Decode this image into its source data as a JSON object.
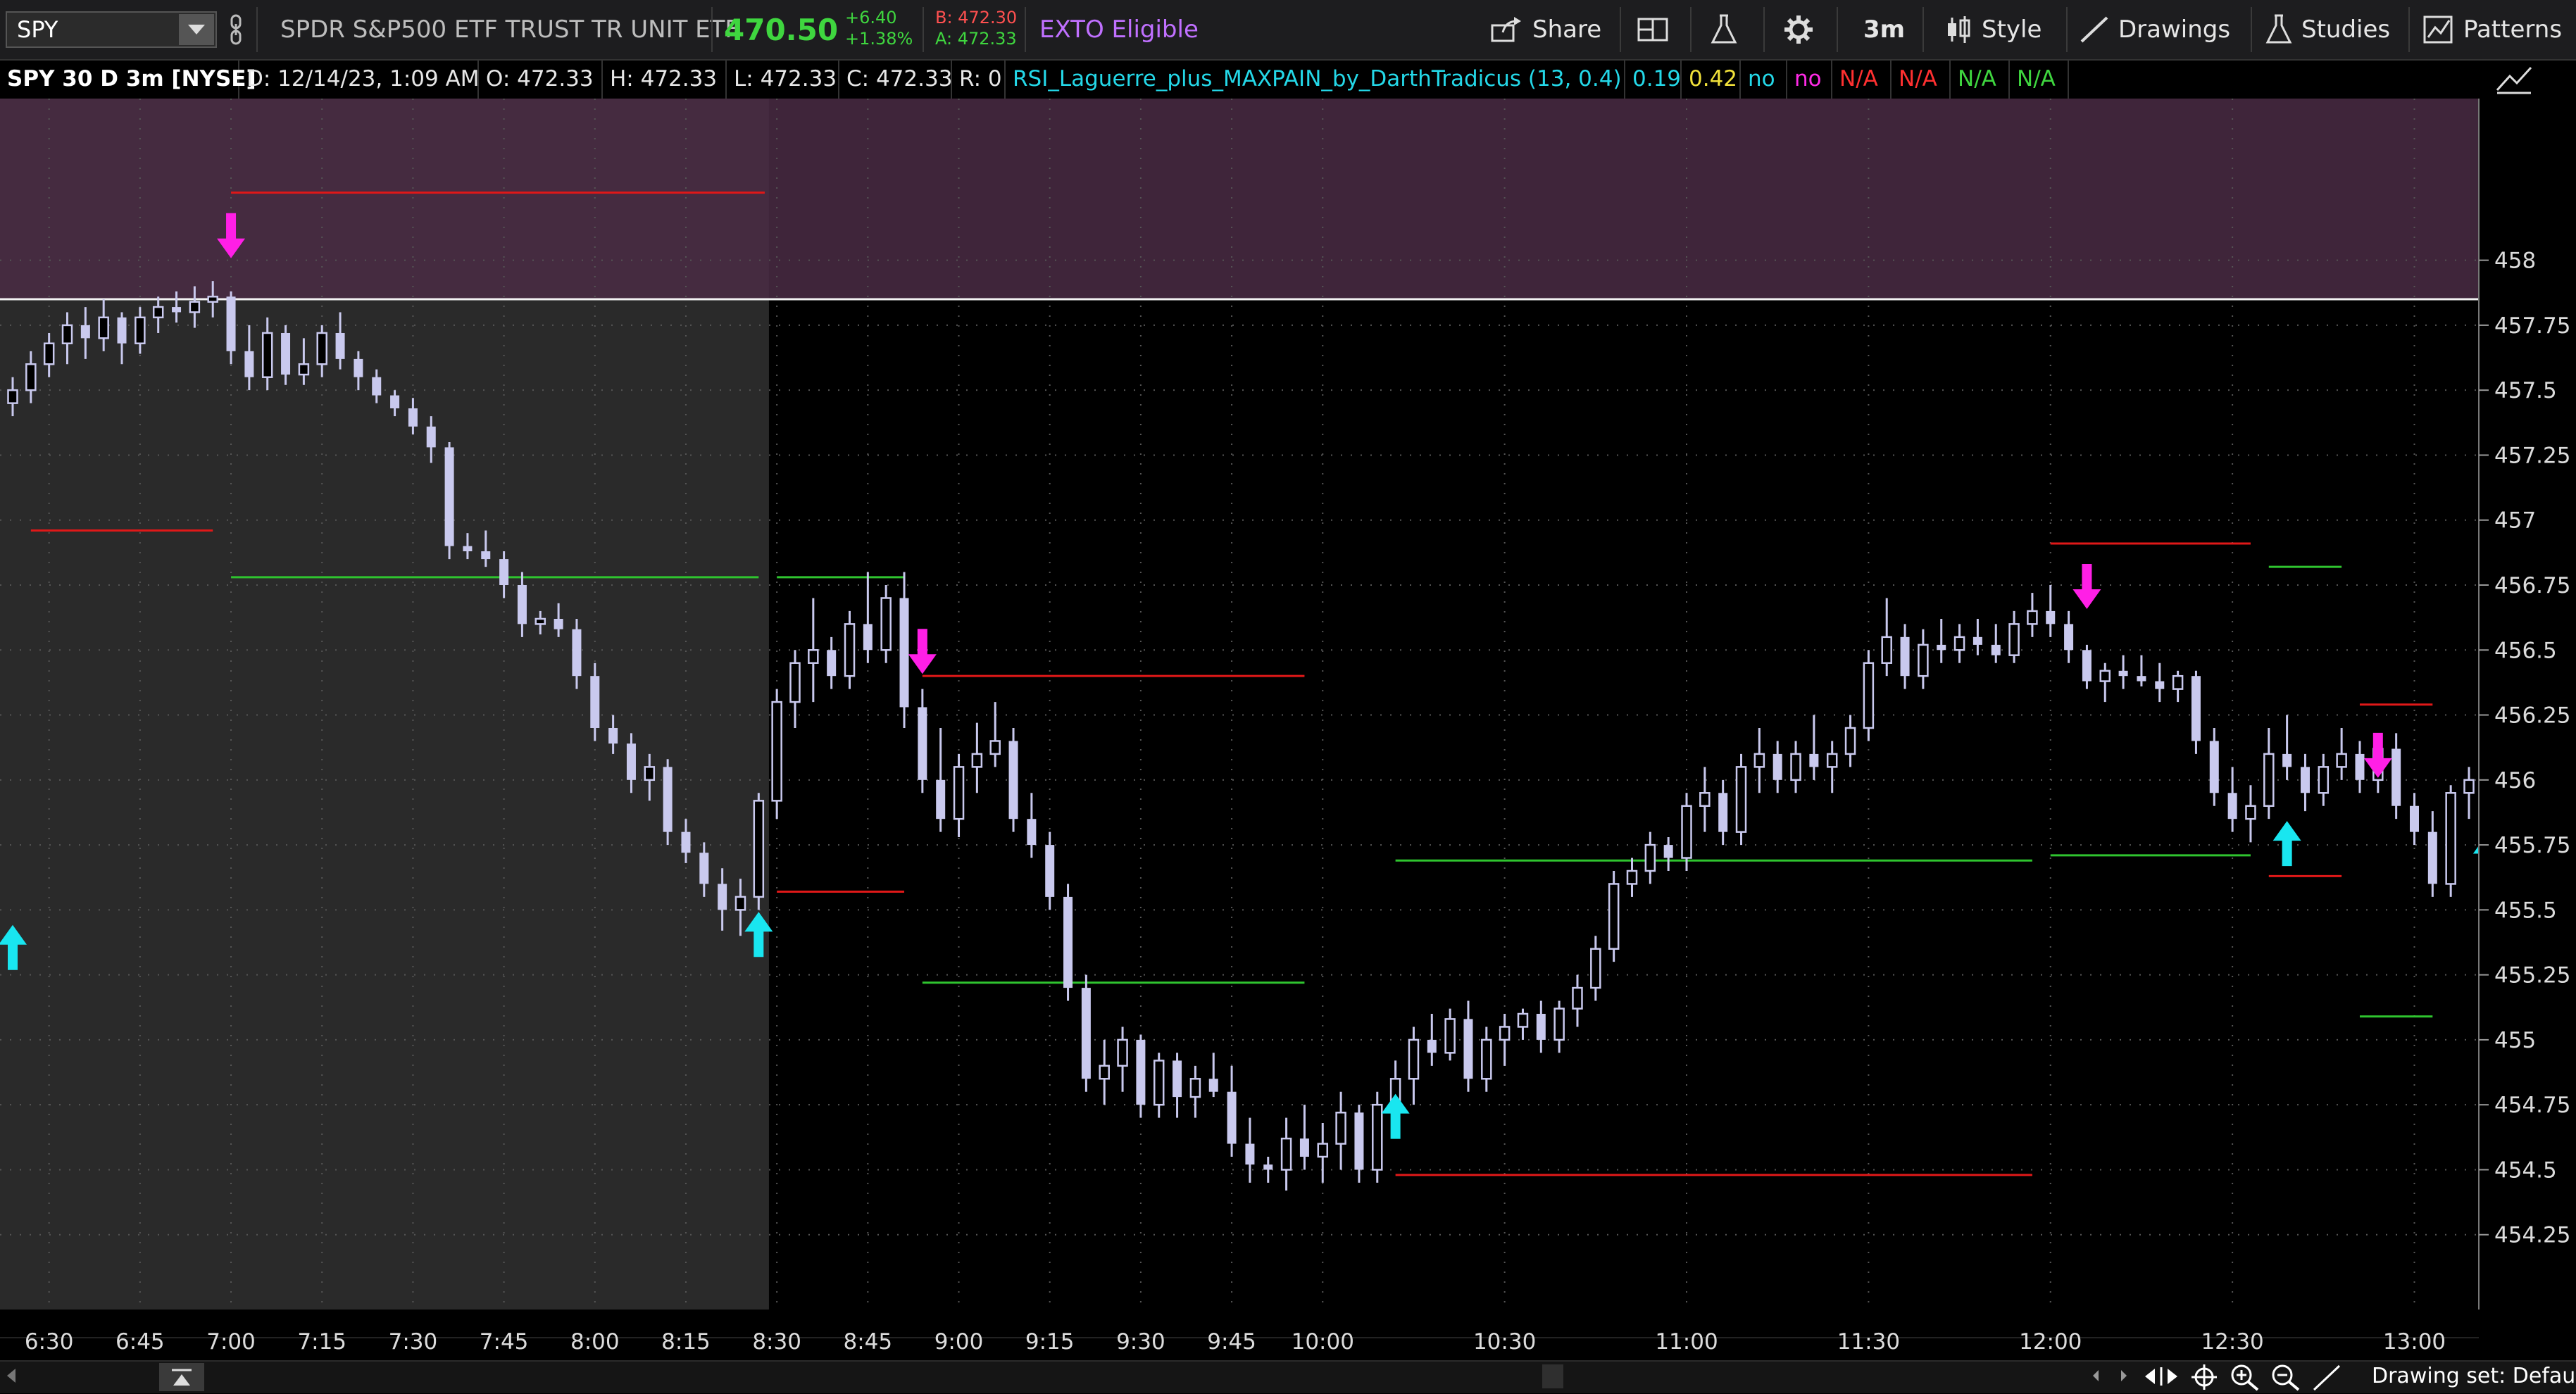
{
  "toolbar": {
    "symbol": "SPY",
    "description": "SPDR S&P500 ETF TRUST TR UNIT ETF",
    "last_price": "470.50",
    "change_abs": "+6.40",
    "change_pct": "+1.38%",
    "bid": "B: 472.30",
    "ask": "A: 472.33",
    "exto": "EXTO Eligible",
    "share": "Share",
    "timeframe": "3m",
    "style": "Style",
    "drawings": "Drawings",
    "studies": "Studies",
    "patterns": "Patterns"
  },
  "infobar": {
    "chart_title": "SPY 30 D 3m [NYSE]",
    "date": "D: 12/14/23, 1:09 AM",
    "open": "O: 472.33",
    "high": "H: 472.33",
    "low": "L: 472.33",
    "close": "C: 472.33",
    "range": "R: 0",
    "study": "RSI_Laguerre_plus_MAXPAIN_by_DarthTradicus (13, 0.4)",
    "v1": "0.19",
    "v2": "0.42",
    "v3": "no",
    "v4": "no",
    "v5": "N/A",
    "v6": "N/A",
    "v7": "N/A",
    "v8": "N/A"
  },
  "footer": {
    "drawing_set": "Drawing set: Defau"
  },
  "colors": {
    "candle": "#c9c9ee",
    "up_arrow": "#19e6f0",
    "down_arrow": "#ff1fe6",
    "red_line": "#e01818",
    "green_line": "#2fc42f",
    "premarket_bg": "#2a2a2a",
    "band": "#4a2c44"
  },
  "chart_data": {
    "type": "candlestick",
    "ylim": [
      454,
      458.4
    ],
    "xlim": [
      "6:24",
      "13:09"
    ],
    "y_ticks": [
      "458",
      "457.75",
      "457.5",
      "457.25",
      "457",
      "456.75",
      "456.5",
      "456.25",
      "456",
      "455.75",
      "455.5",
      "455.25",
      "455",
      "454.75",
      "454.5",
      "454.25"
    ],
    "x_ticks": [
      "6:30",
      "6:45",
      "7:00",
      "7:15",
      "7:30",
      "7:45",
      "8:00",
      "8:15",
      "8:30",
      "8:45",
      "9:00",
      "9:15",
      "9:30",
      "9:45",
      "10:00",
      "10:30",
      "11:00",
      "11:30",
      "12:00",
      "12:30",
      "13:00"
    ],
    "premarket_end": "8:28",
    "band": [
      457.85,
      458.3
    ],
    "white_line": 457.85,
    "candles": [
      [
        "6:24",
        457.45,
        457.55,
        457.4,
        457.5
      ],
      [
        "6:27",
        457.5,
        457.65,
        457.45,
        457.6
      ],
      [
        "6:30",
        457.6,
        457.72,
        457.55,
        457.68
      ],
      [
        "6:33",
        457.68,
        457.8,
        457.6,
        457.75
      ],
      [
        "6:36",
        457.75,
        457.82,
        457.62,
        457.7
      ],
      [
        "6:39",
        457.7,
        457.85,
        457.65,
        457.78
      ],
      [
        "6:42",
        457.78,
        457.8,
        457.6,
        457.68
      ],
      [
        "6:45",
        457.68,
        457.82,
        457.64,
        457.78
      ],
      [
        "6:48",
        457.78,
        457.86,
        457.72,
        457.82
      ],
      [
        "6:51",
        457.82,
        457.88,
        457.76,
        457.8
      ],
      [
        "6:54",
        457.8,
        457.9,
        457.74,
        457.84
      ],
      [
        "6:57",
        457.84,
        457.92,
        457.78,
        457.86
      ],
      [
        "7:00",
        457.86,
        457.88,
        457.6,
        457.65
      ],
      [
        "7:03",
        457.65,
        457.75,
        457.5,
        457.55
      ],
      [
        "7:06",
        457.55,
        457.78,
        457.5,
        457.72
      ],
      [
        "7:09",
        457.72,
        457.75,
        457.52,
        457.56
      ],
      [
        "7:12",
        457.56,
        457.7,
        457.52,
        457.6
      ],
      [
        "7:15",
        457.6,
        457.75,
        457.55,
        457.72
      ],
      [
        "7:18",
        457.72,
        457.8,
        457.58,
        457.62
      ],
      [
        "7:21",
        457.62,
        457.65,
        457.5,
        457.55
      ],
      [
        "7:24",
        457.55,
        457.58,
        457.45,
        457.48
      ],
      [
        "7:27",
        457.48,
        457.5,
        457.4,
        457.43
      ],
      [
        "7:30",
        457.43,
        457.47,
        457.33,
        457.36
      ],
      [
        "7:33",
        457.36,
        457.4,
        457.22,
        457.28
      ],
      [
        "7:36",
        457.28,
        457.3,
        456.85,
        456.9
      ],
      [
        "7:39",
        456.9,
        456.95,
        456.85,
        456.88
      ],
      [
        "7:42",
        456.88,
        456.96,
        456.82,
        456.85
      ],
      [
        "7:45",
        456.85,
        456.88,
        456.7,
        456.75
      ],
      [
        "7:48",
        456.75,
        456.8,
        456.55,
        456.6
      ],
      [
        "7:51",
        456.6,
        456.65,
        456.56,
        456.62
      ],
      [
        "7:54",
        456.62,
        456.68,
        456.55,
        456.58
      ],
      [
        "7:57",
        456.58,
        456.62,
        456.35,
        456.4
      ],
      [
        "8:00",
        456.4,
        456.45,
        456.15,
        456.2
      ],
      [
        "8:03",
        456.2,
        456.25,
        456.1,
        456.14
      ],
      [
        "8:06",
        456.14,
        456.18,
        455.95,
        456.0
      ],
      [
        "8:09",
        456.0,
        456.1,
        455.92,
        456.05
      ],
      [
        "8:12",
        456.05,
        456.08,
        455.75,
        455.8
      ],
      [
        "8:15",
        455.8,
        455.85,
        455.68,
        455.72
      ],
      [
        "8:18",
        455.72,
        455.76,
        455.55,
        455.6
      ],
      [
        "8:21",
        455.6,
        455.66,
        455.42,
        455.5
      ],
      [
        "8:24",
        455.5,
        455.62,
        455.4,
        455.55
      ],
      [
        "8:27",
        455.55,
        455.95,
        455.5,
        455.92
      ],
      [
        "8:30",
        455.92,
        456.35,
        455.85,
        456.3
      ],
      [
        "8:33",
        456.3,
        456.5,
        456.2,
        456.45
      ],
      [
        "8:36",
        456.45,
        456.7,
        456.3,
        456.5
      ],
      [
        "8:39",
        456.5,
        456.55,
        456.35,
        456.4
      ],
      [
        "8:42",
        456.4,
        456.65,
        456.35,
        456.6
      ],
      [
        "8:45",
        456.6,
        456.8,
        456.45,
        456.5
      ],
      [
        "8:48",
        456.5,
        456.75,
        456.45,
        456.7
      ],
      [
        "8:51",
        456.7,
        456.8,
        456.2,
        456.28
      ],
      [
        "8:54",
        456.28,
        456.35,
        455.95,
        456.0
      ],
      [
        "8:57",
        456.0,
        456.2,
        455.8,
        455.85
      ],
      [
        "9:00",
        455.85,
        456.1,
        455.78,
        456.05
      ],
      [
        "9:03",
        456.05,
        456.22,
        455.95,
        456.1
      ],
      [
        "9:06",
        456.1,
        456.3,
        456.05,
        456.15
      ],
      [
        "9:09",
        456.15,
        456.2,
        455.8,
        455.85
      ],
      [
        "9:12",
        455.85,
        455.95,
        455.7,
        455.75
      ],
      [
        "9:15",
        455.75,
        455.8,
        455.5,
        455.55
      ],
      [
        "9:18",
        455.55,
        455.6,
        455.15,
        455.2
      ],
      [
        "9:21",
        455.2,
        455.25,
        454.8,
        454.85
      ],
      [
        "9:24",
        454.85,
        455.0,
        454.75,
        454.9
      ],
      [
        "9:27",
        454.9,
        455.05,
        454.8,
        455.0
      ],
      [
        "9:30",
        455.0,
        455.02,
        454.7,
        454.75
      ],
      [
        "9:33",
        454.75,
        454.95,
        454.7,
        454.92
      ],
      [
        "9:36",
        454.92,
        454.95,
        454.7,
        454.78
      ],
      [
        "9:39",
        454.78,
        454.9,
        454.7,
        454.85
      ],
      [
        "9:42",
        454.85,
        454.95,
        454.78,
        454.8
      ],
      [
        "9:45",
        454.8,
        454.9,
        454.55,
        454.6
      ],
      [
        "9:48",
        454.6,
        454.7,
        454.45,
        454.52
      ],
      [
        "9:51",
        454.52,
        454.55,
        454.45,
        454.5
      ],
      [
        "9:54",
        454.5,
        454.7,
        454.42,
        454.62
      ],
      [
        "9:57",
        454.62,
        454.75,
        454.5,
        454.55
      ],
      [
        "10:00",
        454.55,
        454.68,
        454.45,
        454.6
      ],
      [
        "10:03",
        454.6,
        454.8,
        454.5,
        454.72
      ],
      [
        "10:06",
        454.72,
        454.75,
        454.45,
        454.5
      ],
      [
        "10:09",
        454.5,
        454.8,
        454.45,
        454.75
      ],
      [
        "10:12",
        454.75,
        454.92,
        454.7,
        454.85
      ],
      [
        "10:15",
        454.85,
        455.05,
        454.75,
        455.0
      ],
      [
        "10:18",
        455.0,
        455.1,
        454.9,
        454.95
      ],
      [
        "10:21",
        454.95,
        455.12,
        454.92,
        455.08
      ],
      [
        "10:24",
        455.08,
        455.15,
        454.8,
        454.85
      ],
      [
        "10:27",
        454.85,
        455.05,
        454.8,
        455.0
      ],
      [
        "10:30",
        455.0,
        455.1,
        454.9,
        455.05
      ],
      [
        "10:33",
        455.05,
        455.12,
        455.0,
        455.1
      ],
      [
        "10:36",
        455.1,
        455.15,
        454.95,
        455.0
      ],
      [
        "10:39",
        455.0,
        455.15,
        454.95,
        455.12
      ],
      [
        "10:42",
        455.12,
        455.25,
        455.05,
        455.2
      ],
      [
        "10:45",
        455.2,
        455.4,
        455.15,
        455.35
      ],
      [
        "10:48",
        455.35,
        455.65,
        455.3,
        455.6
      ],
      [
        "10:51",
        455.6,
        455.7,
        455.55,
        455.65
      ],
      [
        "10:54",
        455.65,
        455.8,
        455.6,
        455.75
      ],
      [
        "10:57",
        455.75,
        455.78,
        455.65,
        455.7
      ],
      [
        "11:00",
        455.7,
        455.95,
        455.65,
        455.9
      ],
      [
        "11:03",
        455.9,
        456.05,
        455.8,
        455.95
      ],
      [
        "11:06",
        455.95,
        456.0,
        455.75,
        455.8
      ],
      [
        "11:09",
        455.8,
        456.1,
        455.75,
        456.05
      ],
      [
        "11:12",
        456.05,
        456.2,
        455.95,
        456.1
      ],
      [
        "11:15",
        456.1,
        456.15,
        455.95,
        456.0
      ],
      [
        "11:18",
        456.0,
        456.15,
        455.95,
        456.1
      ],
      [
        "11:21",
        456.1,
        456.25,
        456.0,
        456.05
      ],
      [
        "11:24",
        456.05,
        456.15,
        455.95,
        456.1
      ],
      [
        "11:27",
        456.1,
        456.25,
        456.05,
        456.2
      ],
      [
        "11:30",
        456.2,
        456.5,
        456.15,
        456.45
      ],
      [
        "11:33",
        456.45,
        456.7,
        456.4,
        456.55
      ],
      [
        "11:36",
        456.55,
        456.6,
        456.35,
        456.4
      ],
      [
        "11:39",
        456.4,
        456.58,
        456.35,
        456.52
      ],
      [
        "11:42",
        456.52,
        456.62,
        456.45,
        456.5
      ],
      [
        "11:45",
        456.5,
        456.6,
        456.45,
        456.55
      ],
      [
        "11:48",
        456.55,
        456.62,
        456.48,
        456.52
      ],
      [
        "11:51",
        456.52,
        456.6,
        456.45,
        456.48
      ],
      [
        "11:54",
        456.48,
        456.65,
        456.45,
        456.6
      ],
      [
        "11:57",
        456.6,
        456.72,
        456.55,
        456.65
      ],
      [
        "12:00",
        456.65,
        456.75,
        456.55,
        456.6
      ],
      [
        "12:03",
        456.6,
        456.65,
        456.45,
        456.5
      ],
      [
        "12:06",
        456.5,
        456.52,
        456.35,
        456.38
      ],
      [
        "12:09",
        456.38,
        456.45,
        456.3,
        456.42
      ],
      [
        "12:12",
        456.42,
        456.48,
        456.35,
        456.4
      ],
      [
        "12:15",
        456.4,
        456.48,
        456.36,
        456.38
      ],
      [
        "12:18",
        456.38,
        456.45,
        456.3,
        456.35
      ],
      [
        "12:21",
        456.35,
        456.42,
        456.3,
        456.4
      ],
      [
        "12:24",
        456.4,
        456.42,
        456.1,
        456.15
      ],
      [
        "12:27",
        456.15,
        456.2,
        455.9,
        455.95
      ],
      [
        "12:30",
        455.95,
        456.05,
        455.8,
        455.85
      ],
      [
        "12:33",
        455.85,
        455.98,
        455.76,
        455.9
      ],
      [
        "12:36",
        455.9,
        456.2,
        455.85,
        456.1
      ],
      [
        "12:39",
        456.1,
        456.25,
        456.0,
        456.05
      ],
      [
        "12:42",
        456.05,
        456.1,
        455.88,
        455.95
      ],
      [
        "12:45",
        455.95,
        456.1,
        455.9,
        456.05
      ],
      [
        "12:48",
        456.05,
        456.2,
        456.0,
        456.1
      ],
      [
        "12:51",
        456.1,
        456.15,
        455.95,
        456.0
      ],
      [
        "12:54",
        456.0,
        456.18,
        455.95,
        456.12
      ],
      [
        "12:57",
        456.12,
        456.18,
        455.85,
        455.9
      ],
      [
        "13:00",
        455.9,
        455.95,
        455.75,
        455.8
      ],
      [
        "13:03",
        455.8,
        455.88,
        455.55,
        455.6
      ],
      [
        "13:06",
        455.6,
        455.98,
        455.55,
        455.95
      ],
      [
        "13:09",
        455.95,
        456.05,
        455.85,
        456.0
      ]
    ],
    "red_lines": [
      [
        "6:27",
        "6:57",
        456.96
      ],
      [
        "7:00",
        "8:28",
        458.26
      ],
      [
        "8:30",
        "8:51",
        455.57
      ],
      [
        "8:54",
        "9:57",
        456.4
      ],
      [
        "10:12",
        "11:57",
        454.48
      ],
      [
        "12:00",
        "12:33",
        456.91
      ],
      [
        "12:36",
        "12:48",
        455.63
      ],
      [
        "12:51",
        "13:03",
        456.29
      ],
      [
        "13:12",
        "13:15",
        455.65
      ]
    ],
    "green_lines": [
      [
        "7:00",
        "8:27",
        456.78
      ],
      [
        "8:30",
        "8:51",
        456.78
      ],
      [
        "8:54",
        "9:57",
        455.22
      ],
      [
        "10:12",
        "11:57",
        455.69
      ],
      [
        "12:00",
        "12:33",
        455.71
      ],
      [
        "12:36",
        "12:48",
        456.82
      ],
      [
        "12:51",
        "13:03",
        455.09
      ],
      [
        "13:12",
        "13:15",
        456.82
      ]
    ],
    "up_arrows": [
      [
        "6:24",
        455.35
      ],
      [
        "8:27",
        455.4
      ],
      [
        "10:12",
        454.7
      ],
      [
        "12:39",
        455.75
      ],
      [
        "13:12",
        455.7
      ]
    ],
    "down_arrows": [
      [
        "7:00",
        458.1
      ],
      [
        "8:54",
        456.5
      ],
      [
        "12:06",
        456.75
      ],
      [
        "12:54",
        456.1
      ]
    ]
  }
}
